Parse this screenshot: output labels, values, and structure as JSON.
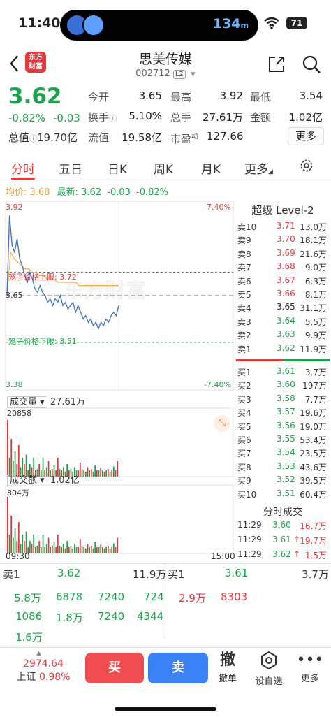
{
  "status_bar": {
    "time": "11:40",
    "island_speed": "134",
    "island_speed_unit": "m",
    "battery": "71"
  },
  "header": {
    "stock_name": "思美传媒",
    "stock_code": "002712",
    "level_badge": "L2",
    "logo_line1": "东方",
    "logo_line2": "财富"
  },
  "quote": {
    "price": "3.62",
    "change_pct": "-0.82%",
    "change": "-0.03",
    "stats": [
      {
        "label": "今开",
        "value": "3.65",
        "value_color": "#222222"
      },
      {
        "label": "最高",
        "value": "3.92",
        "value_color": "#e4393c"
      },
      {
        "label": "最低",
        "value": "3.54",
        "value_color": "#1aa34a"
      },
      {
        "label": "换手",
        "value": "5.10%",
        "value_color": "#222222"
      },
      {
        "label": "总手",
        "value": "27.61万",
        "value_color": "#222222"
      },
      {
        "label": "金额",
        "value": "1.02亿",
        "value_color": "#222222"
      },
      {
        "label": "流值",
        "value": "19.58亿",
        "value_color": "#222222"
      },
      {
        "label": "市盈",
        "value": "127.66",
        "value_color": "#222222"
      }
    ],
    "total_value_label": "总值",
    "total_value": "19.70亿",
    "pe_superscript": "动",
    "more_label": "更多"
  },
  "tabs": [
    {
      "label": "分时",
      "active": true
    },
    {
      "label": "五日",
      "active": false
    },
    {
      "label": "日K",
      "active": false
    },
    {
      "label": "周K",
      "active": false
    },
    {
      "label": "月K",
      "active": false
    },
    {
      "label": "更多",
      "active": false
    }
  ],
  "avg_row": {
    "avg_label": "均价:",
    "avg_value": "3.68",
    "latest_label": "最新:",
    "latest_value": "3.62",
    "latest_change": "-0.03",
    "latest_pct": "-0.82%"
  },
  "chart_data": {
    "type": "line",
    "y_high": "3.92",
    "y_mid": "3.65",
    "y_low": "3.38",
    "pct_high": "7.40%",
    "pct_low": "-7.40%",
    "upper_limit_label": "笼子价格上限: 3.72",
    "lower_limit_label": "笼子价格下限: 3.51",
    "upper_limit": 3.72,
    "lower_limit": 3.51,
    "prev_close": 3.65,
    "ylim": [
      3.38,
      3.92
    ],
    "x_start": "09:30",
    "x_end": "15:00",
    "price_series": [
      3.65,
      3.89,
      3.8,
      3.78,
      3.82,
      3.76,
      3.74,
      3.71,
      3.69,
      3.72,
      3.7,
      3.67,
      3.66,
      3.68,
      3.66,
      3.65,
      3.63,
      3.64,
      3.62,
      3.64,
      3.63,
      3.65,
      3.62,
      3.63,
      3.61,
      3.62,
      3.63,
      3.6,
      3.62,
      3.6,
      3.58,
      3.59,
      3.57,
      3.58,
      3.56,
      3.57,
      3.55,
      3.57,
      3.56,
      3.58,
      3.57,
      3.59,
      3.6,
      3.59,
      3.62
    ],
    "avg_series": [
      3.65,
      3.78,
      3.76,
      3.75,
      3.74,
      3.73,
      3.73,
      3.72,
      3.72,
      3.71,
      3.71,
      3.7,
      3.7,
      3.7,
      3.69,
      3.69,
      3.69,
      3.69,
      3.69,
      3.69,
      3.68,
      3.68,
      3.68,
      3.68,
      3.68,
      3.68,
      3.68,
      3.68,
      3.68,
      3.68,
      3.68,
      3.68
    ],
    "volume_label": "成交量",
    "volume_total": "27.61万",
    "volume_max": "20858",
    "amount_label": "成交额",
    "amount_total": "1.02亿",
    "amount_max": "804万",
    "volume_bars": [
      0.9,
      0.3,
      0.6,
      0.25,
      0.4,
      0.2,
      0.5,
      0.15,
      0.3,
      0.2,
      0.35,
      0.1,
      0.2,
      0.15,
      0.3,
      0.1,
      0.12,
      0.2,
      0.1,
      0.3,
      0.1,
      0.15,
      0.25,
      0.1,
      0.12,
      0.18,
      0.1,
      0.3,
      0.12,
      0.1,
      0.15,
      0.08,
      0.2,
      0.1,
      0.12,
      0.08,
      0.15,
      0.1,
      0.1,
      0.22,
      0.12,
      0.1,
      0.08,
      0.15,
      0.1,
      0.12,
      0.08,
      0.18,
      0.1,
      0.1,
      0.14,
      0.1,
      0.08,
      0.1,
      0.12,
      0.08,
      0.1,
      0.16,
      0.1,
      0.25
    ],
    "volume_colors": [
      "r",
      "g",
      "r",
      "g",
      "g",
      "r",
      "r",
      "g",
      "g",
      "r",
      "g",
      "r",
      "g",
      "r",
      "g",
      "r",
      "g",
      "r",
      "g",
      "g",
      "r",
      "g",
      "r",
      "g",
      "r",
      "g",
      "r",
      "r",
      "g",
      "r",
      "g",
      "r",
      "g",
      "r",
      "g",
      "r",
      "g",
      "g",
      "r",
      "r",
      "g",
      "r",
      "g",
      "r",
      "g",
      "r",
      "g",
      "g",
      "r",
      "g",
      "r",
      "g",
      "r",
      "g",
      "r",
      "g",
      "r",
      "g",
      "r",
      "r"
    ]
  },
  "level2": {
    "title": "超级 Level-2",
    "asks": [
      {
        "label": "卖10",
        "price": "3.71",
        "vol": "13.0万",
        "color": "#e4393c"
      },
      {
        "label": "卖9",
        "price": "3.70",
        "vol": "18.1万",
        "color": "#e4393c"
      },
      {
        "label": "卖8",
        "price": "3.69",
        "vol": "21.6万",
        "color": "#e4393c"
      },
      {
        "label": "卖7",
        "price": "3.68",
        "vol": "9.0万",
        "color": "#e4393c"
      },
      {
        "label": "卖6",
        "price": "3.67",
        "vol": "6.3万",
        "color": "#e4393c"
      },
      {
        "label": "卖5",
        "price": "3.66",
        "vol": "8.1万",
        "color": "#e4393c"
      },
      {
        "label": "卖4",
        "price": "3.65",
        "vol": "31.1万",
        "color": "#222222"
      },
      {
        "label": "卖3",
        "price": "3.64",
        "vol": "5.5万",
        "color": "#1aa34a"
      },
      {
        "label": "卖2",
        "price": "3.63",
        "vol": "9.9万",
        "color": "#1aa34a"
      },
      {
        "label": "卖1",
        "price": "3.62",
        "vol": "11.9万",
        "color": "#1aa34a"
      }
    ],
    "bids": [
      {
        "label": "买1",
        "price": "3.61",
        "vol": "3.7万",
        "color": "#1aa34a"
      },
      {
        "label": "买2",
        "price": "3.60",
        "vol": "197万",
        "color": "#1aa34a"
      },
      {
        "label": "买3",
        "price": "3.58",
        "vol": "7.7万",
        "color": "#1aa34a"
      },
      {
        "label": "买4",
        "price": "3.57",
        "vol": "19.6万",
        "color": "#1aa34a"
      },
      {
        "label": "买5",
        "price": "3.56",
        "vol": "19.0万",
        "color": "#1aa34a"
      },
      {
        "label": "买6",
        "price": "3.55",
        "vol": "53.4万",
        "color": "#1aa34a"
      },
      {
        "label": "买7",
        "price": "3.54",
        "vol": "23.5万",
        "color": "#1aa34a"
      },
      {
        "label": "买8",
        "price": "3.53",
        "vol": "43.6万",
        "color": "#1aa34a"
      },
      {
        "label": "买9",
        "price": "3.52",
        "vol": "39.5万",
        "color": "#1aa34a"
      },
      {
        "label": "买10",
        "price": "3.51",
        "vol": "60.4万",
        "color": "#1aa34a"
      }
    ],
    "ticks_title": "分时成交",
    "ticks": [
      {
        "time": "11:29",
        "price": "3.60",
        "vol": "16.7万",
        "pcolor": "#1aa34a",
        "vcolor": "#e4393c",
        "arrow": ""
      },
      {
        "time": "11:29",
        "price": "3.61",
        "vol": "19.7万",
        "pcolor": "#1aa34a",
        "vcolor": "#e4393c",
        "arrow": "↑"
      },
      {
        "time": "11:29",
        "price": "3.62",
        "vol": "1.5万",
        "pcolor": "#1aa34a",
        "vcolor": "#e4393c",
        "arrow": "↑"
      }
    ]
  },
  "book": {
    "sell_label": "卖1",
    "sell_price": "3.62",
    "sell_vol": "11.9万",
    "buy_label": "买1",
    "buy_price": "3.61",
    "buy_vol": "3.7万",
    "sell_queue": [
      "5.8万",
      "6878",
      "7240",
      "724",
      "1086",
      "1.8万",
      "7240",
      "4344",
      "1.6万"
    ],
    "buy_queue": [
      "2.9万",
      "8303"
    ]
  },
  "bottom": {
    "index_value": "2974.64",
    "index_name": "上证",
    "index_pct": "0.98%",
    "buy_label": "买",
    "sell_label": "卖",
    "cancel_icon": "撤",
    "cancel_label": "撤单",
    "watchlist_label": "设自选",
    "more_label": "更多"
  }
}
